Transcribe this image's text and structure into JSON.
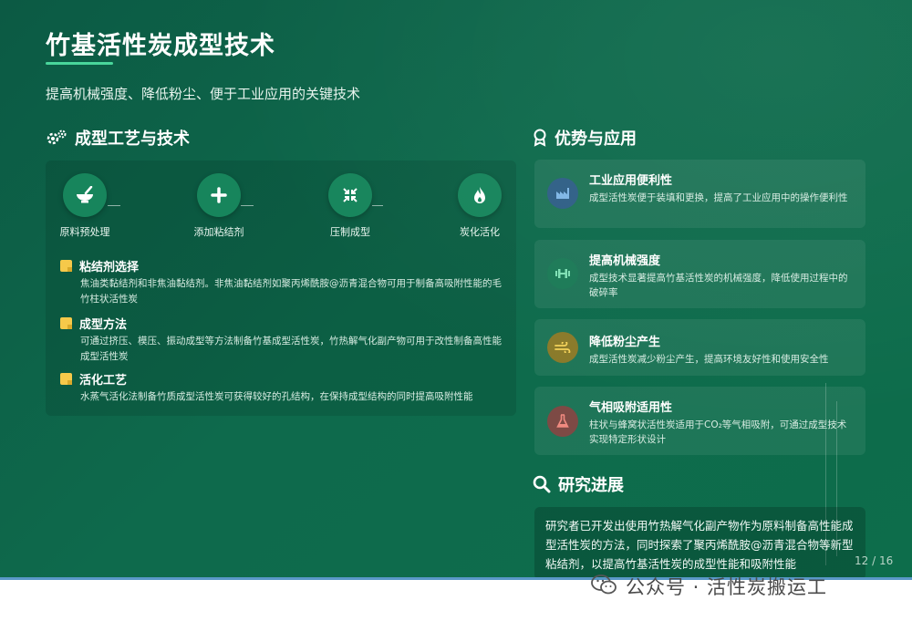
{
  "header": {
    "title": "竹基活性炭成型技术",
    "subtitle": "提高机械强度、降低粉尘、便于工业应用的关键技术"
  },
  "left_section": {
    "heading": "成型工艺与技术",
    "heading_icon": "gears-icon",
    "steps": [
      {
        "label": "原料预处理",
        "icon": "mortar-icon"
      },
      {
        "label": "添加粘结剂",
        "icon": "plus-icon"
      },
      {
        "label": "压制成型",
        "icon": "compress-icon"
      },
      {
        "label": "炭化活化",
        "icon": "fire-icon"
      }
    ],
    "items": [
      {
        "title": "粘结剂选择",
        "body": "焦油类黏结剂和非焦油黏结剂。非焦油黏结剂如聚丙烯酰胺@沥青混合物可用于制备高吸附性能的毛竹柱状活性炭"
      },
      {
        "title": "成型方法",
        "body": "可通过挤压、模压、振动成型等方法制备竹基成型活性炭，竹热解气化副产物可用于改性制备高性能成型活性炭"
      },
      {
        "title": "活化工艺",
        "body": "水蒸气活化法制备竹质成型活性炭可获得较好的孔结构，在保持成型结构的同时提高吸附性能"
      }
    ]
  },
  "right_section": {
    "heading": "优势与应用",
    "heading_icon": "award-icon",
    "cards": [
      {
        "title": "工业应用便利性",
        "desc": "成型活性炭便于装填和更换，提高了工业应用中的操作便利性",
        "icon": "factory-icon",
        "color": "#3b82c4"
      },
      {
        "title": "提高机械强度",
        "desc": "成型技术显著提高竹基活性炭的机械强度，降低使用过程中的破碎率",
        "icon": "dumbbell-icon",
        "color": "#1f9a6a"
      },
      {
        "title": "降低粉尘产生",
        "desc": "成型活性炭减少粉尘产生，提高环境友好性和使用安全性",
        "icon": "wind-icon",
        "color": "#c9a62a"
      },
      {
        "title": "气相吸附适用性",
        "desc": "柱状与蜂窝状活性炭适用于CO₂等气相吸附，可通过成型技术实现特定形状设计",
        "icon": "flask-icon",
        "color": "#c0504d"
      }
    ]
  },
  "research": {
    "heading": "研究进展",
    "heading_icon": "search-icon",
    "text": "研究者已开发出使用竹热解气化副产物作为原料制备高性能成型活性炭的方法，同时探索了聚丙烯酰胺@沥青混合物等新型粘结剂，以提高竹基活性炭的成型性能和吸附性能"
  },
  "page_number": "12 / 16",
  "watermark": {
    "text": "公众号 · 活性炭搬运工",
    "icon": "wechat-icon"
  },
  "colors": {
    "background": "#0e6a4c",
    "accent": "#49d69b",
    "note": "#f6c94a"
  }
}
